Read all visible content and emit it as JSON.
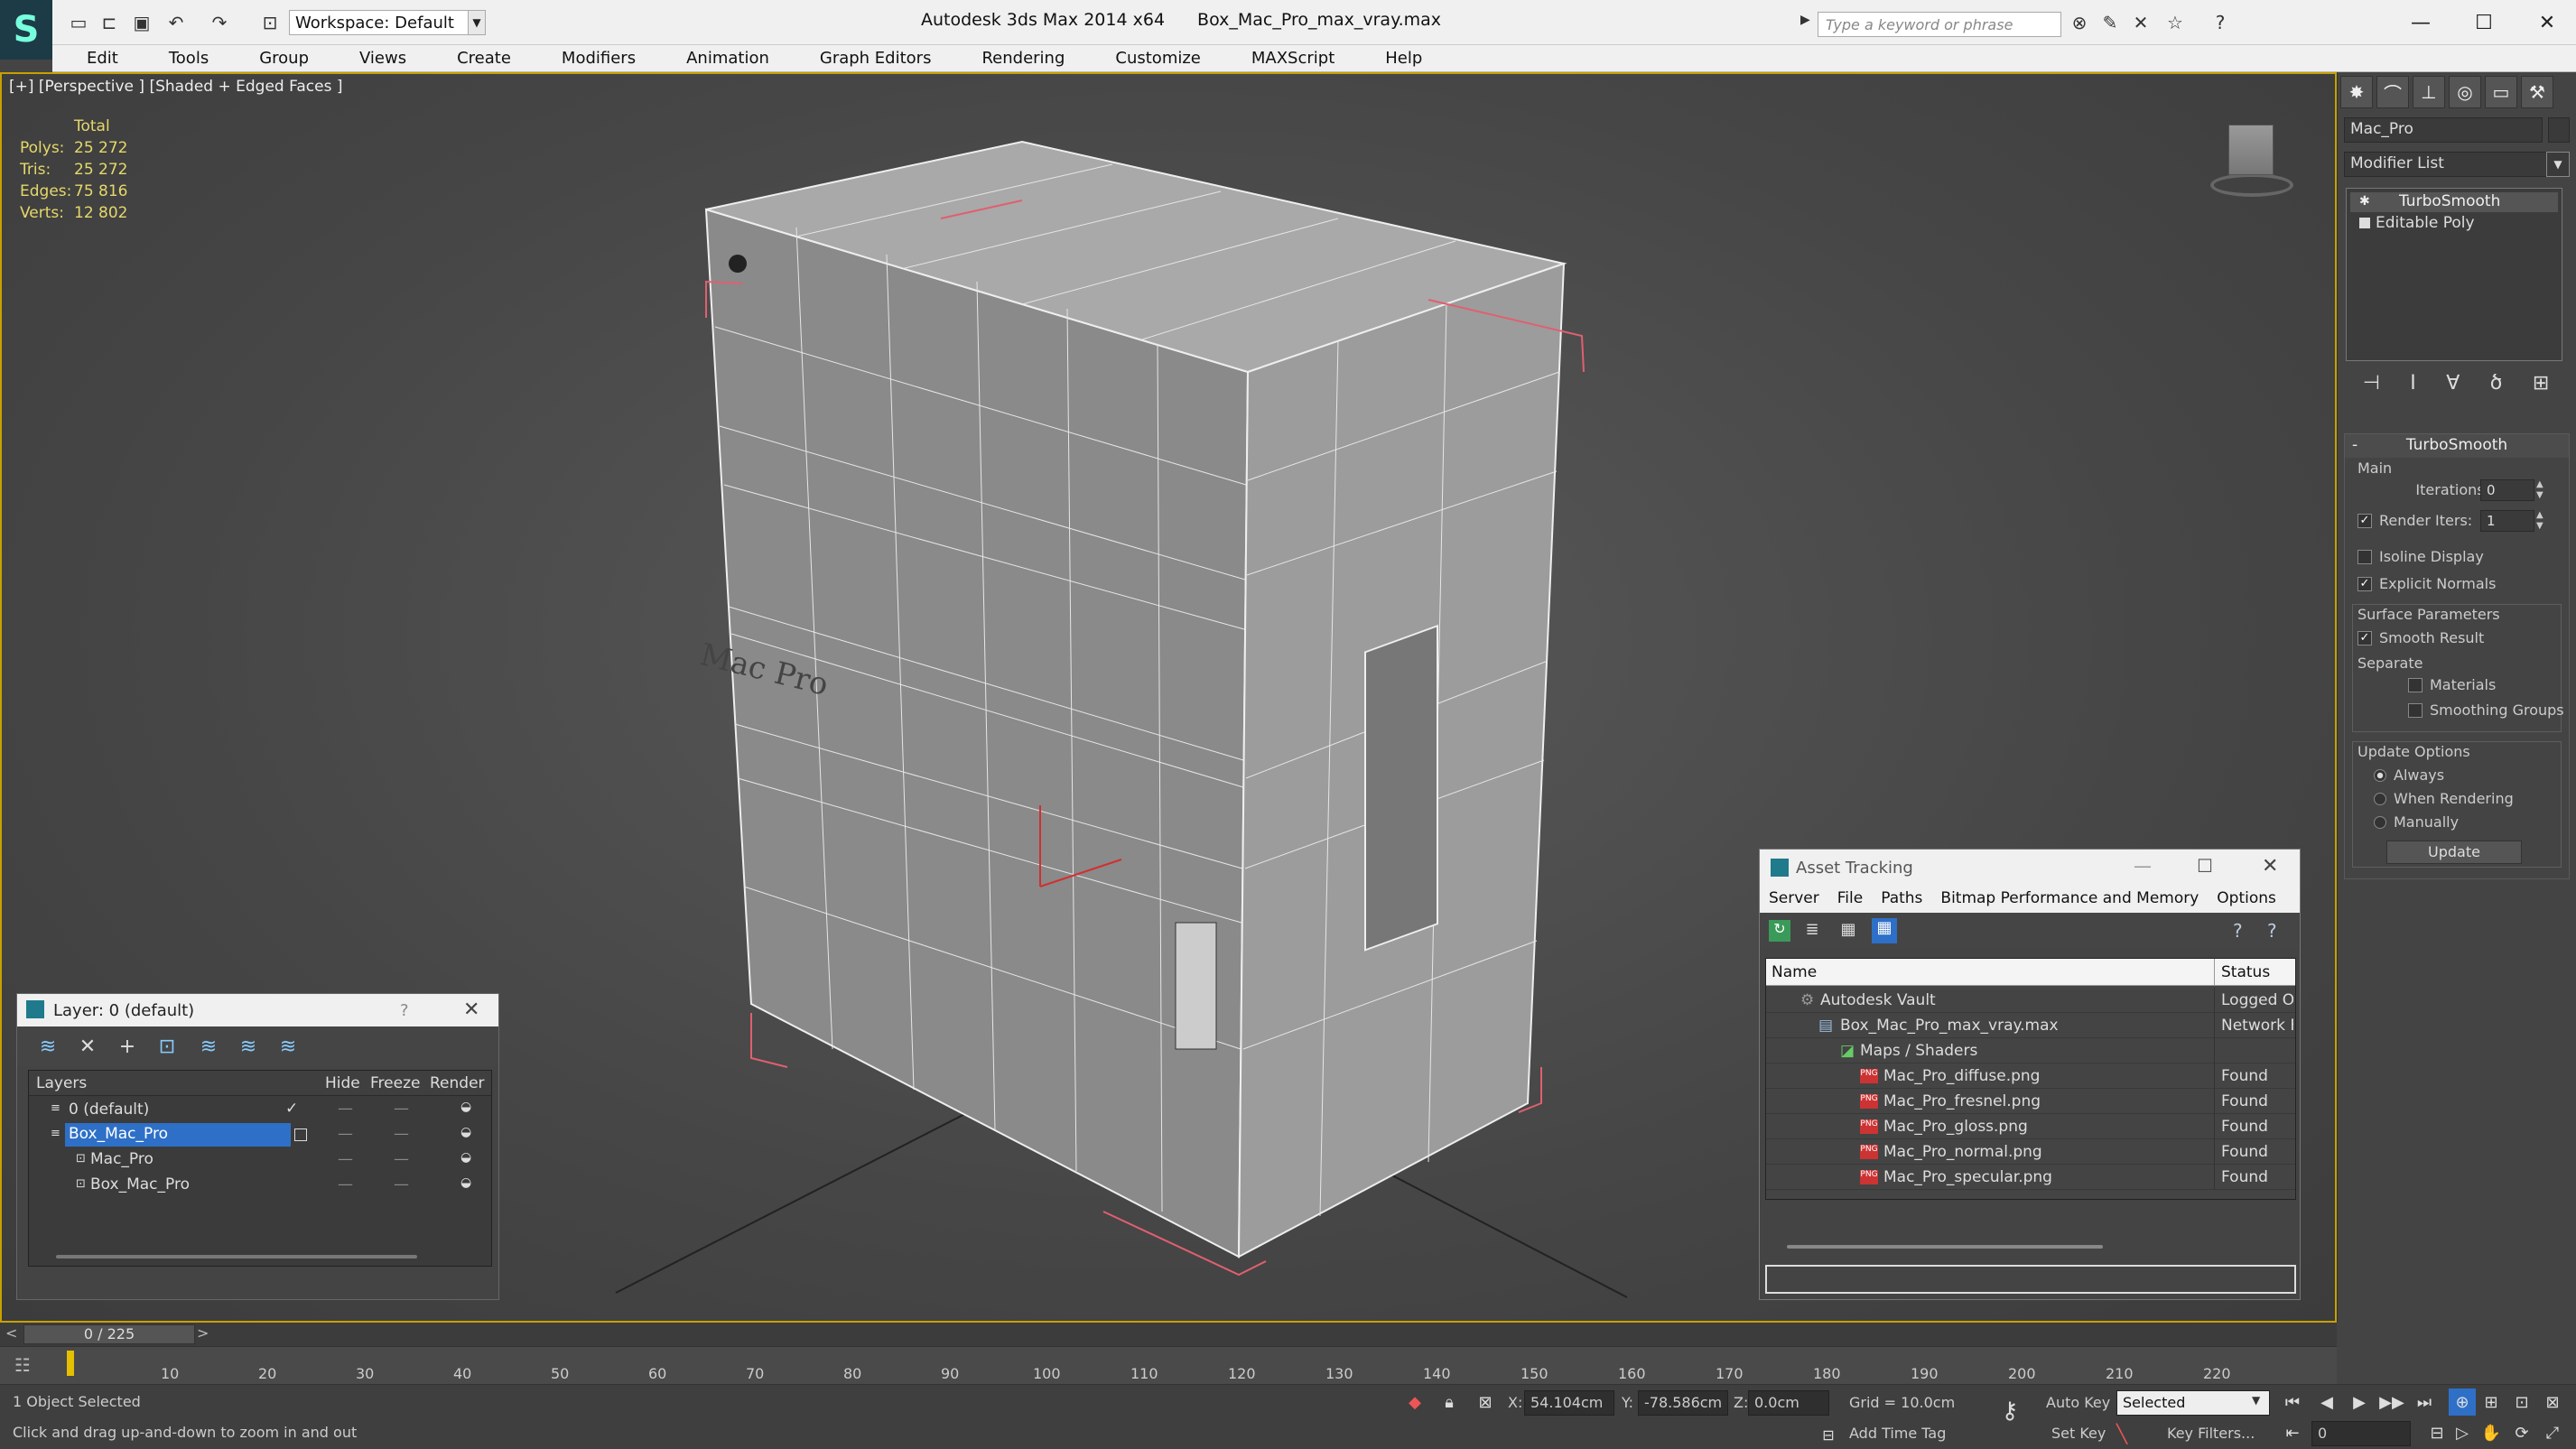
{
  "app": {
    "title": "Autodesk 3ds Max  2014 x64",
    "file": "Box_Mac_Pro_max_vray.max",
    "workspace": "Workspace: Default",
    "search_placeholder": "Type a keyword or phrase"
  },
  "menu": [
    "Edit",
    "Tools",
    "Group",
    "Views",
    "Create",
    "Modifiers",
    "Animation",
    "Graph Editors",
    "Rendering",
    "Customize",
    "MAXScript",
    "Help"
  ],
  "viewport": {
    "label": "[+] [Perspective ] [Shaded + Edged Faces ]",
    "stats": {
      "header": "Total",
      "rows": [
        {
          "k": "Polys:",
          "v": "25 272"
        },
        {
          "k": "Tris:",
          "v": "25 272"
        },
        {
          "k": "Edges:",
          "v": "75 816"
        },
        {
          "k": "Verts:",
          "v": "12 802"
        }
      ]
    },
    "box_text": "Mac Pro"
  },
  "command_panel": {
    "object_name": "Mac_Pro",
    "modifier_list": "Modifier List",
    "stack": [
      "TurboSmooth",
      "Editable Poly"
    ],
    "turbosmooth": {
      "title": "TurboSmooth",
      "main": "Main",
      "iterations_label": "Iterations:",
      "iterations": "0",
      "render_iters_label": "Render Iters:",
      "render_iters": "1",
      "isoline": "Isoline Display",
      "explicit_normals": "Explicit Normals",
      "surface_params": "Surface Parameters",
      "smooth_result": "Smooth Result",
      "separate": "Separate",
      "materials": "Materials",
      "smoothing_groups": "Smoothing Groups",
      "update_options": "Update Options",
      "always": "Always",
      "when_rendering": "When Rendering",
      "manually": "Manually",
      "update": "Update"
    }
  },
  "layer_dialog": {
    "title": "Layer: 0 (default)",
    "help": "?",
    "columns": [
      "Layers",
      "Hide",
      "Freeze",
      "Render"
    ],
    "rows": [
      {
        "name": "0 (default)",
        "active": true,
        "selected": false,
        "indent": 0
      },
      {
        "name": "Box_Mac_Pro",
        "active": false,
        "selected": true,
        "indent": 0
      },
      {
        "name": "Mac_Pro",
        "active": false,
        "selected": false,
        "indent": 1
      },
      {
        "name": "Box_Mac_Pro",
        "active": false,
        "selected": false,
        "indent": 1
      }
    ]
  },
  "asset_tracking": {
    "title": "Asset Tracking",
    "menu": [
      "Server",
      "File",
      "Paths",
      "Bitmap Performance and Memory",
      "Options"
    ],
    "columns": [
      "Name",
      "Status"
    ],
    "rows": [
      {
        "name": "Autodesk Vault",
        "status": "Logged O",
        "indent": 0
      },
      {
        "name": "Box_Mac_Pro_max_vray.max",
        "status": "Network F",
        "indent": 1
      },
      {
        "name": "Maps / Shaders",
        "status": "",
        "indent": 2
      },
      {
        "name": "Mac_Pro_diffuse.png",
        "status": "Found",
        "indent": 3
      },
      {
        "name": "Mac_Pro_fresnel.png",
        "status": "Found",
        "indent": 3
      },
      {
        "name": "Mac_Pro_gloss.png",
        "status": "Found",
        "indent": 3
      },
      {
        "name": "Mac_Pro_normal.png",
        "status": "Found",
        "indent": 3
      },
      {
        "name": "Mac_Pro_specular.png",
        "status": "Found",
        "indent": 3
      }
    ]
  },
  "timeline": {
    "frame": "0 / 225",
    "ticks": [
      "10",
      "20",
      "30",
      "40",
      "50",
      "60",
      "70",
      "80",
      "90",
      "100",
      "110",
      "120",
      "130",
      "140",
      "150",
      "160",
      "170",
      "180",
      "190",
      "200",
      "210",
      "220"
    ]
  },
  "status": {
    "selected": "1 Object Selected",
    "prompt": "Click and drag up-and-down to zoom in and out",
    "x_label": "X:",
    "x": "54.104cm",
    "y_label": "Y:",
    "y": "-78.586cm",
    "z_label": "Z:",
    "z": "0.0cm",
    "grid": "Grid = 10.0cm",
    "auto_key": "Auto Key",
    "selected_dropdown": "Selected",
    "set_key": "Set Key",
    "key_filters": "Key Filters...",
    "add_time_tag": "Add Time Tag",
    "frame_field": "0"
  },
  "colors": {
    "accent": "#2e70c8",
    "stats": "#e5d86a",
    "viewport_border": "#c8a000"
  }
}
